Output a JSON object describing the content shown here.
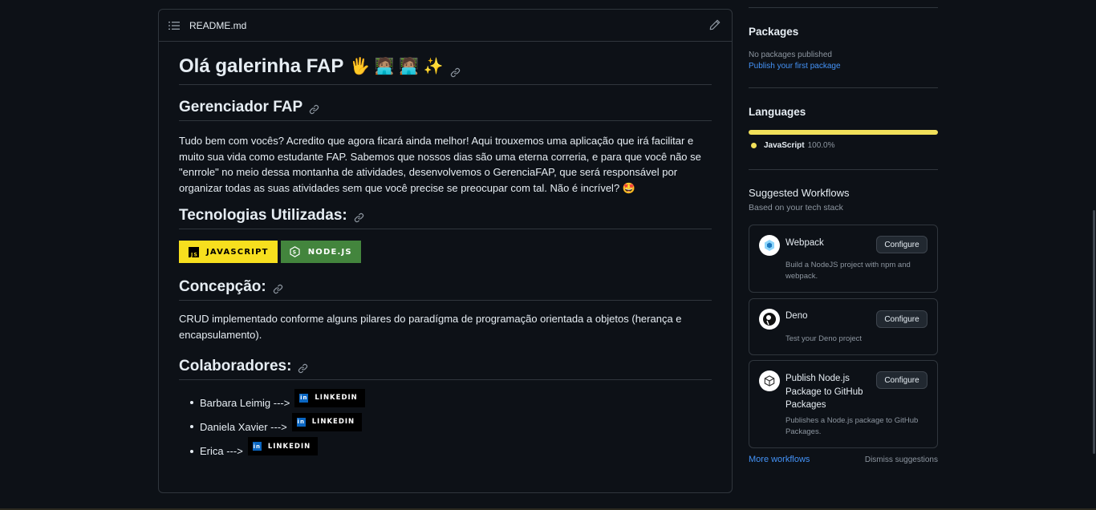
{
  "readme": {
    "filename": "README.md",
    "title": "Olá galerinha FAP",
    "title_emojis": "🖐 🧑🏽‍💻 🧑🏽‍💻 ✨",
    "sections": {
      "gerenciador": {
        "heading": "Gerenciador FAP",
        "text": "Tudo bem com vocês? Acredito que agora ficará ainda melhor! Aqui trouxemos uma aplicação que irá facilitar e muito sua vida como estudante FAP. Sabemos que nossos dias são uma eterna correria, e para que você não se \"enrrole\" no meio dessa montanha de atividades, desenvolvemos o GerenciaFAP, que será responsável por organizar todas as suas atividades sem que você precise se preocupar com tal. Não é incrível? 🤩"
      },
      "tecnologias": {
        "heading": "Tecnologias Utilizadas:",
        "badges": [
          {
            "label": "JAVASCRIPT",
            "bg": "#f7df1e",
            "color": "#000000"
          },
          {
            "label": "NODE.JS",
            "bg": "#43853d",
            "color": "#ffffff"
          }
        ]
      },
      "concepcao": {
        "heading": "Concepção:",
        "text": "CRUD implementado conforme alguns pilares do paradígma de programação orientada a objetos (herança e encapsulamento)."
      },
      "colaboradores": {
        "heading": "Colaboradores:",
        "items": [
          {
            "name": "Barbara Leimig --->",
            "badge": "LINKEDIN"
          },
          {
            "name": "Daniela Xavier --->",
            "badge": "LINKEDIN"
          },
          {
            "name": "Erica --->",
            "badge": "LINKEDIN"
          }
        ]
      }
    }
  },
  "sidebar": {
    "packages": {
      "heading": "Packages",
      "empty_text": "No packages published",
      "publish_link": "Publish your first package"
    },
    "languages": {
      "heading": "Languages",
      "items": [
        {
          "name": "JavaScript",
          "percent": "100.0%",
          "fraction": 1.0,
          "color": "#f1e05a"
        }
      ]
    },
    "workflows": {
      "heading": "Suggested Workflows",
      "subheading": "Based on your tech stack",
      "cards": [
        {
          "title": "Webpack",
          "description": "Build a NodeJS project with npm and webpack.",
          "button": "Configure",
          "icon": "webpack-icon"
        },
        {
          "title": "Deno",
          "description": "Test your Deno project",
          "button": "Configure",
          "icon": "deno-icon"
        },
        {
          "title": "Publish Node.js Package to GitHub Packages",
          "description": "Publishes a Node.js package to GitHub Packages.",
          "button": "Configure",
          "icon": "package-icon"
        }
      ],
      "more_link": "More workflows",
      "dismiss_link": "Dismiss suggestions"
    }
  },
  "colors": {
    "background": "#0d1117",
    "border": "#30363d",
    "link": "#4493f8",
    "muted": "#8d96a0",
    "text": "#e6edf3"
  }
}
